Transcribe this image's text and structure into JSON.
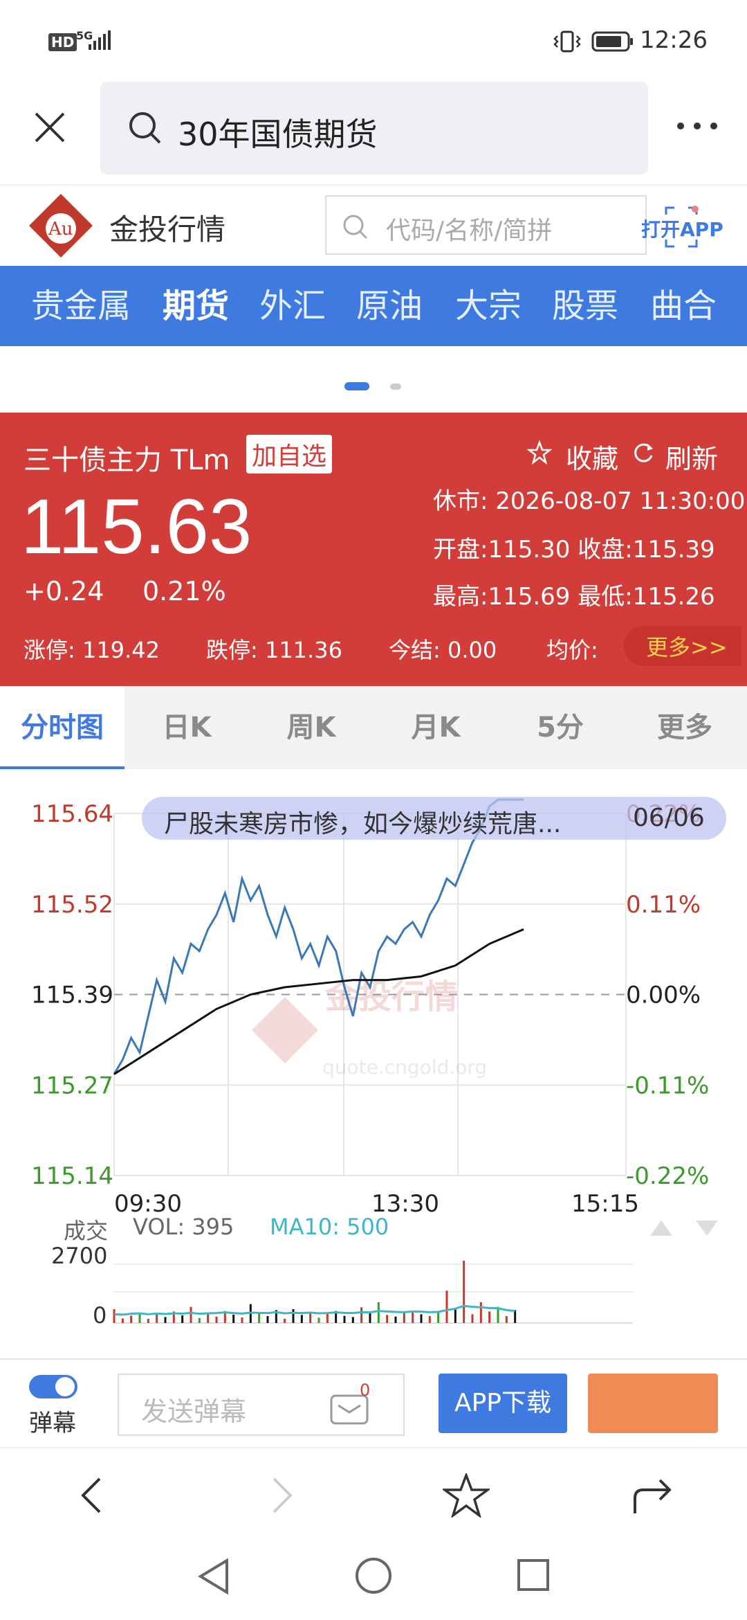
{
  "status_bar": {
    "hd": "HD",
    "net": "5G",
    "time": "12:26"
  },
  "search": {
    "query": "30年国债期货"
  },
  "site": {
    "name": "金投行情",
    "logo_text": "Au",
    "search_placeholder": "代码/名称/简拼",
    "open_app": "打开APP"
  },
  "nav": {
    "items": [
      "贵金属",
      "期货",
      "外汇",
      "原油",
      "大宗",
      "股票",
      "曲合"
    ],
    "active": 1
  },
  "quote": {
    "name": "三十债主力 TLm",
    "add_watch": "加自选",
    "favorite": "收藏",
    "refresh": "刷新",
    "price": "115.63",
    "change": "+0.24",
    "change_pct": "0.21%",
    "status_time": "休市: 2026-08-07 11:30:00",
    "open_close": "开盘:115.30 收盘:115.39",
    "high_low": "最高:115.69 最低:115.26",
    "limit_up": "涨停: 119.42",
    "limit_down": "跌停: 111.36",
    "settle": "今结: 0.00",
    "avg": "均价:",
    "more": "更多>>"
  },
  "tabs": [
    "分时图",
    "日K",
    "周K",
    "月K",
    "5分",
    "更多"
  ],
  "active_tab": 0,
  "chart": {
    "banner": "尸股未寒房市惨，如今爆炒续荒唐...",
    "banner_date": "06/06",
    "watermark_text": "金投行情",
    "watermark_url": "quote.cngold.org",
    "vol_label": "成交",
    "vol_value": "VOL: 395",
    "ma_value": "MA10: 500",
    "vol_ticks": [
      "2700",
      "0"
    ]
  },
  "chart_data": {
    "type": "line",
    "title": "",
    "x_ticks": [
      "09:30",
      "13:30",
      "15:15"
    ],
    "y_ticks": [
      "115.64",
      "115.52",
      "115.39",
      "115.27",
      "115.14"
    ],
    "y_right_ticks": [
      "0.22%",
      "0.11%",
      "0.00%",
      "-0.11%",
      "-0.22%"
    ],
    "ylim": [
      115.14,
      115.64
    ],
    "xlim": [
      0,
      60
    ],
    "reference": 115.39,
    "series": [
      {
        "name": "",
        "color": "#3a78b8",
        "x": [
          0,
          1,
          2,
          3,
          4,
          5,
          6,
          7,
          8,
          9,
          10,
          11,
          12,
          13,
          14,
          15,
          16,
          17,
          18,
          19,
          20,
          21,
          22,
          23,
          24,
          25,
          26,
          27,
          28,
          29,
          30,
          31,
          32,
          33,
          34,
          35,
          36,
          37,
          38,
          39,
          40,
          41,
          42,
          43,
          44,
          45,
          46,
          47,
          48
        ],
        "y": [
          115.28,
          115.3,
          115.33,
          115.31,
          115.36,
          115.41,
          115.38,
          115.44,
          115.42,
          115.46,
          115.45,
          115.48,
          115.5,
          115.53,
          115.49,
          115.55,
          115.52,
          115.54,
          115.5,
          115.47,
          115.51,
          115.48,
          115.44,
          115.46,
          115.43,
          115.47,
          115.45,
          115.4,
          115.36,
          115.42,
          115.4,
          115.45,
          115.47,
          115.46,
          115.48,
          115.49,
          115.47,
          115.5,
          115.52,
          115.55,
          115.54,
          115.57,
          115.6,
          115.62,
          115.65,
          115.67,
          115.69,
          115.68,
          115.66
        ]
      },
      {
        "name": "",
        "color": "#111111",
        "x": [
          0,
          4,
          8,
          12,
          16,
          20,
          24,
          28,
          32,
          36,
          40,
          44,
          48
        ],
        "y": [
          115.28,
          115.31,
          115.34,
          115.37,
          115.39,
          115.4,
          115.405,
          115.41,
          115.41,
          115.415,
          115.43,
          115.46,
          115.48
        ]
      }
    ],
    "volume": {
      "max": 2700,
      "ma_color": "#3fb6c8",
      "values": [
        600,
        200,
        320,
        450,
        180,
        380,
        260,
        500,
        330,
        700,
        220,
        410,
        280,
        520,
        360,
        240,
        820,
        410,
        300,
        560,
        190,
        600,
        350,
        460,
        230,
        390,
        520,
        310,
        260,
        680,
        420,
        900,
        350,
        280,
        460,
        520,
        380,
        300,
        440,
        1400,
        600,
        2700,
        380,
        900,
        500,
        700,
        300,
        560
      ],
      "ma10": [
        380,
        360,
        400,
        420,
        380,
        410,
        390,
        420,
        410,
        440,
        400,
        420,
        430,
        460,
        430,
        410,
        450,
        440,
        430,
        470,
        420,
        440,
        430,
        450,
        420,
        430,
        460,
        440,
        430,
        470,
        460,
        520,
        500,
        480,
        470,
        500,
        490,
        470,
        480,
        560,
        620,
        740,
        700,
        680,
        650,
        640,
        560,
        520
      ]
    }
  },
  "bottom": {
    "danmaku_label": "弹幕",
    "send_placeholder": "发送弹幕",
    "msg_count": "0",
    "app_download": "APP下载"
  },
  "colors": {
    "brand_blue": "#3f7ae0",
    "quote_red": "#d23d3a",
    "up_red": "#c0392b",
    "down_green": "#3a9a2a",
    "orange": "#ef8b55"
  }
}
